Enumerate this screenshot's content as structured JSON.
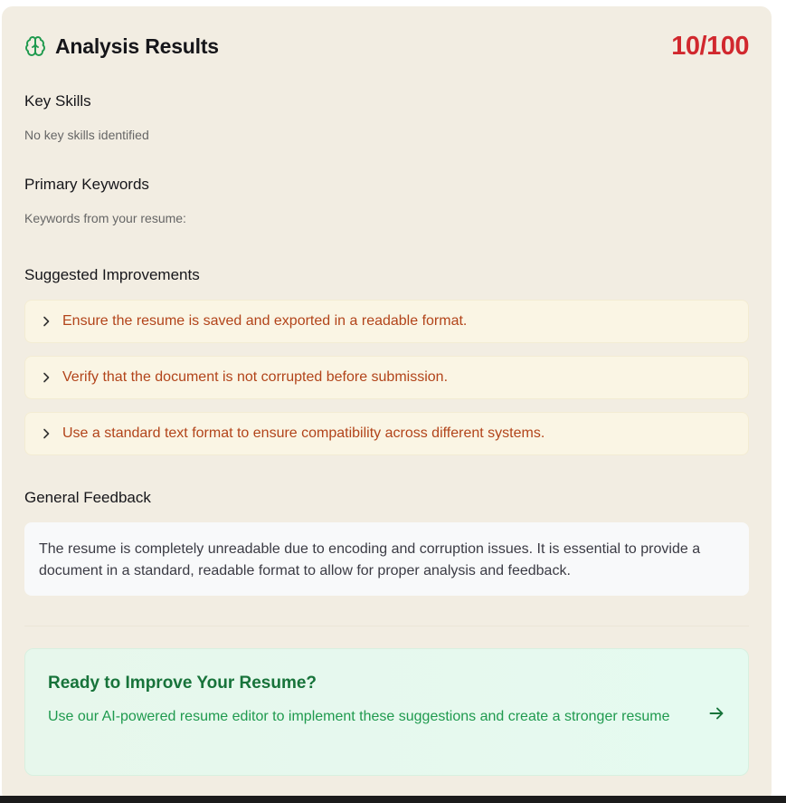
{
  "header": {
    "title": "Analysis Results",
    "score": "10/100",
    "icon": "brain-icon"
  },
  "key_skills": {
    "heading": "Key Skills",
    "empty_text": "No key skills identified"
  },
  "primary_keywords": {
    "heading": "Primary Keywords",
    "subtitle": "Keywords from your resume:"
  },
  "improvements": {
    "heading": "Suggested Improvements",
    "items": [
      {
        "text": "Ensure the resume is saved and exported in a readable format.",
        "icon": "chevron-right-icon"
      },
      {
        "text": "Verify that the document is not corrupted before submission.",
        "icon": "chevron-right-icon"
      },
      {
        "text": "Use a standard text format to ensure compatibility across different systems.",
        "icon": "chevron-right-icon"
      }
    ]
  },
  "feedback": {
    "heading": "General Feedback",
    "text": "The resume is completely unreadable due to encoding and corruption issues. It is essential to provide a document in a standard, readable format to allow for proper analysis and feedback."
  },
  "cta": {
    "title": "Ready to Improve Your Resume?",
    "description": "Use our AI-powered resume editor to implement these suggestions and create a stronger resume",
    "icon": "arrow-right-icon"
  },
  "colors": {
    "card_bg": "#f2ede2",
    "score": "#d1282e",
    "brain_icon": "#1f9a4e",
    "improvement_text": "#b2441a",
    "improvement_bg": "#faf5e4",
    "cta_title": "#17733a",
    "cta_text": "#1f9a4e",
    "cta_bg": "#e7f7ec"
  }
}
